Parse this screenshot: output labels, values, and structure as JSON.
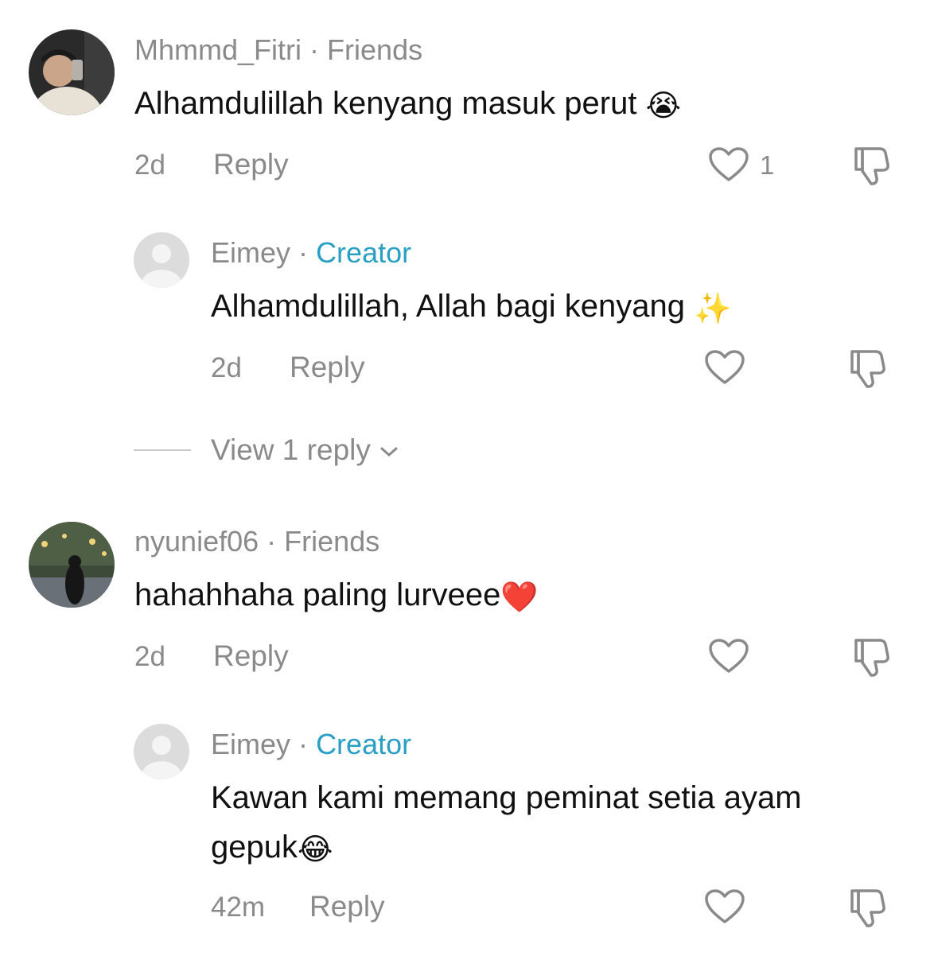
{
  "comments": [
    {
      "username": "Mhmmd_Fitri",
      "separator": "·",
      "badge": "Friends",
      "text": "Alhamdulillah kenyang masuk perut",
      "emoji": "😭",
      "time": "2d",
      "reply_label": "Reply",
      "like_count": "1"
    },
    {
      "username": "Eimey",
      "separator": "·",
      "badge": "Creator",
      "text": "Alhamdulillah, Allah bagi kenyang",
      "emoji": "✨",
      "time": "2d",
      "reply_label": "Reply"
    },
    {
      "username": "nyunief06",
      "separator": "·",
      "badge": "Friends",
      "text": "hahahhaha paling lurveee",
      "emoji": "❤️",
      "time": "2d",
      "reply_label": "Reply"
    },
    {
      "username": "Eimey",
      "separator": "·",
      "badge": "Creator",
      "text_line1": "Kawan kami memang peminat setia ayam",
      "text_line2": "gepuk",
      "emoji": "😂",
      "time": "42m",
      "reply_label": "Reply"
    }
  ],
  "view_replies": {
    "label": "View 1 reply"
  },
  "colors": {
    "muted": "#8a8a8a",
    "text": "#111111",
    "creator": "#2a9fc6"
  },
  "icons": [
    "heart-icon",
    "dislike-icon",
    "chevron-down-icon",
    "default-avatar-icon"
  ]
}
